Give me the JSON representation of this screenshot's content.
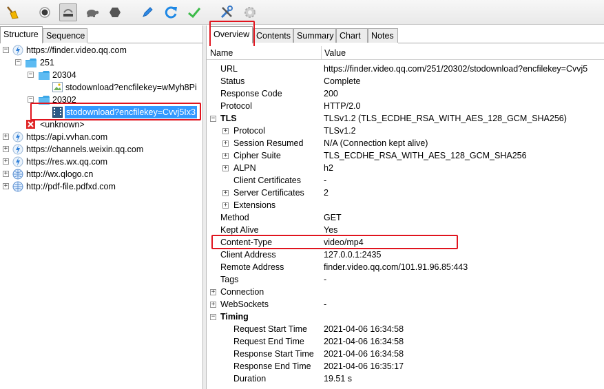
{
  "toolbar": {
    "icons": [
      "broom-icon",
      "record-icon",
      "throttle-icon",
      "turtle-icon",
      "stop-icon",
      "pen-icon",
      "refresh-icon",
      "check-icon",
      "tools-icon",
      "settings-icon"
    ]
  },
  "left_tabs": [
    "Structure",
    "Sequence"
  ],
  "tree": {
    "host_root": "https://finder.video.qq.com",
    "folder_251": "251",
    "folder_20304": "20304",
    "item_20304": "stodownload?encfilekey=wMyh8Pi",
    "folder_20302": "20302",
    "item_20302": "stodownload?encfilekey=Cvvj5Ix3",
    "unknown": "<unknown>",
    "hosts": [
      "https://api.vvhan.com",
      "https://channels.weixin.qq.com",
      "https://res.wx.qq.com",
      "http://wx.qlogo.cn",
      "http://pdf-file.pdfxd.com"
    ]
  },
  "right_tabs": [
    "Overview",
    "Contents",
    "Summary",
    "Chart",
    "Notes"
  ],
  "columns": {
    "name": "Name",
    "value": "Value"
  },
  "overview": [
    {
      "name": "URL",
      "value": "https://finder.video.qq.com/251/20302/stodownload?encfilekey=Cvvj5"
    },
    {
      "name": "Status",
      "value": "Complete"
    },
    {
      "name": "Response Code",
      "value": "200"
    },
    {
      "name": "Protocol",
      "value": "HTTP/2.0"
    },
    {
      "name": "TLS",
      "value": "TLSv1.2 (TLS_ECDHE_RSA_WITH_AES_128_GCM_SHA256)"
    },
    {
      "name": "Protocol",
      "value": "TLSv1.2"
    },
    {
      "name": "Session Resumed",
      "value": "N/A (Connection kept alive)"
    },
    {
      "name": "Cipher Suite",
      "value": "TLS_ECDHE_RSA_WITH_AES_128_GCM_SHA256"
    },
    {
      "name": "ALPN",
      "value": "h2"
    },
    {
      "name": "Client Certificates",
      "value": "-"
    },
    {
      "name": "Server Certificates",
      "value": "2"
    },
    {
      "name": "Extensions",
      "value": ""
    },
    {
      "name": "Method",
      "value": "GET"
    },
    {
      "name": "Kept Alive",
      "value": "Yes"
    },
    {
      "name": "Content-Type",
      "value": "video/mp4"
    },
    {
      "name": "Client Address",
      "value": "127.0.0.1:2435"
    },
    {
      "name": "Remote Address",
      "value": "finder.video.qq.com/101.91.96.85:443"
    },
    {
      "name": "Tags",
      "value": "-"
    },
    {
      "name": "Connection",
      "value": ""
    },
    {
      "name": "WebSockets",
      "value": "-"
    },
    {
      "name": "Timing",
      "value": ""
    },
    {
      "name": "Request Start Time",
      "value": "2021-04-06 16:34:58"
    },
    {
      "name": "Request End Time",
      "value": "2021-04-06 16:34:58"
    },
    {
      "name": "Response Start Time",
      "value": "2021-04-06 16:34:58"
    },
    {
      "name": "Response End Time",
      "value": "2021-04-06 16:35:17"
    },
    {
      "name": "Duration",
      "value": "19.51 s"
    }
  ],
  "colors": {
    "highlight": "#e0141e",
    "selection": "#3399ff"
  }
}
